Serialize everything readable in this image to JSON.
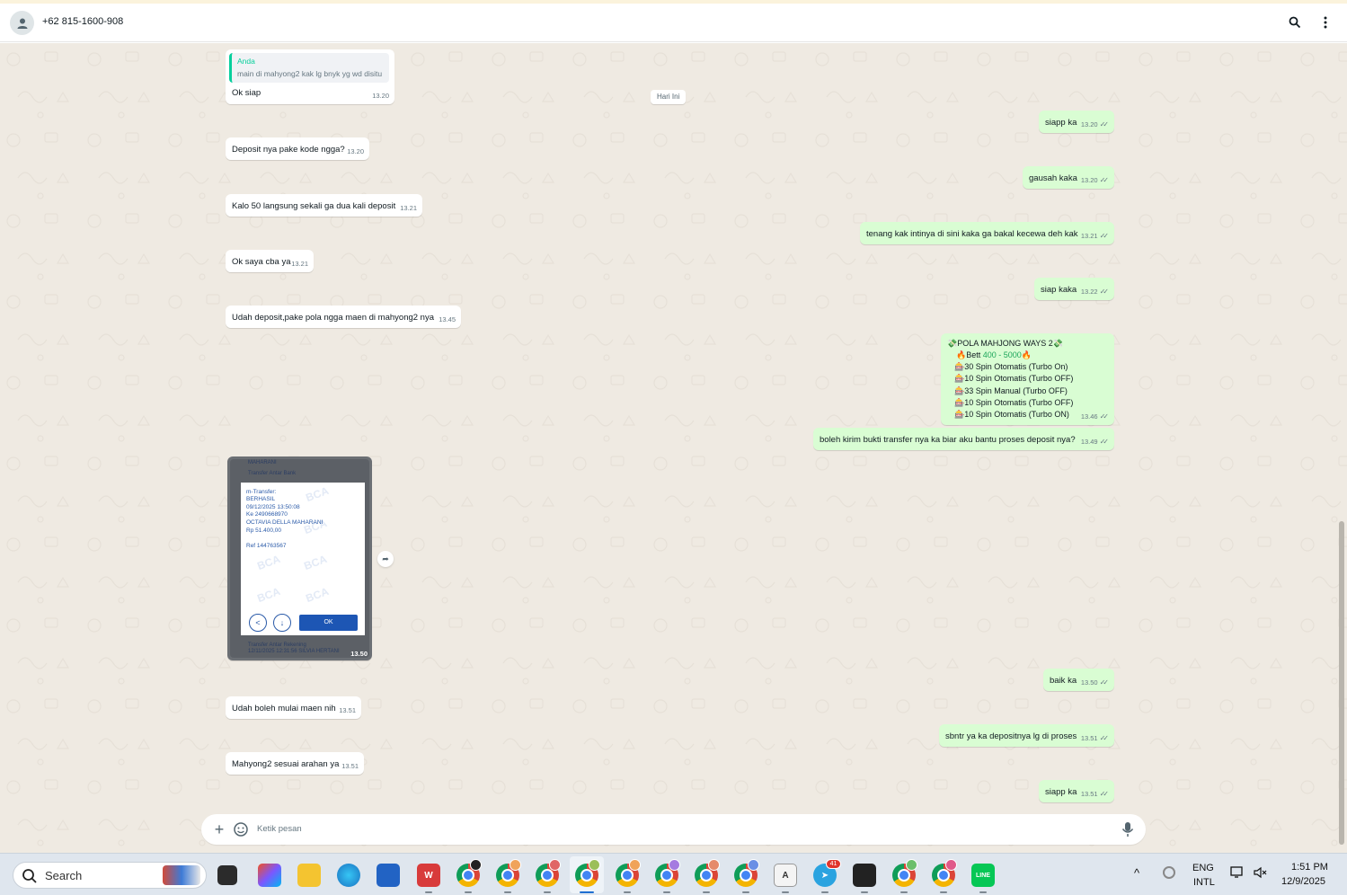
{
  "header": {
    "contact_name": "+62 815-1600-908"
  },
  "chat": {
    "day_label": "Hari Ini",
    "messages": [
      {
        "dir": "in",
        "quote_name": "Anda",
        "quote_text": "main di mahyong2 kak lg bnyk yg wd disitu",
        "text": "Ok siap",
        "time": "13.20"
      },
      {
        "dir": "out",
        "text": "siapp ka",
        "time": "13.20"
      },
      {
        "dir": "in",
        "text": "Deposit nya pake kode ngga?",
        "time": "13.20"
      },
      {
        "dir": "out",
        "text": "gausah kaka",
        "time": "13.20"
      },
      {
        "dir": "in",
        "text": "Kalo 50 langsung sekali ga dua kali deposit",
        "time": "13.21"
      },
      {
        "dir": "out",
        "text": "tenang kak intinya di sini kaka ga bakal kecewa deh kak",
        "time": "13.21"
      },
      {
        "dir": "in",
        "text": "Ok saya cba ya",
        "time": "13.21"
      },
      {
        "dir": "out",
        "text": "siap kaka",
        "time": "13.22"
      },
      {
        "dir": "in",
        "text": "Udah deposit,pake pola ngga maen di mahyong2  nya",
        "time": "13.45"
      },
      {
        "dir": "out",
        "text": "boleh kirim bukti transfer nya ka biar aku bantu proses deposit nya?",
        "time": "13.49"
      },
      {
        "dir": "out",
        "text": "baik ka",
        "time": "13.50"
      },
      {
        "dir": "in",
        "text": "Udah boleh mulai maen nih",
        "time": "13.51"
      },
      {
        "dir": "out",
        "text": "sbntr ya ka depositnya lg di proses",
        "time": "13.51"
      },
      {
        "dir": "in",
        "text": "Mahyong2 sesuai arahan ya",
        "time": "13.51"
      },
      {
        "dir": "out",
        "text": "siapp ka",
        "time": "13.51"
      }
    ],
    "pola": {
      "title": "POLA MAHJONG WAYS 2",
      "bet_prefix": "Bett ",
      "bet_range": "400 - 5000",
      "lines": [
        "30 Spin Otomatis (Turbo On)",
        "10 Spin Otomatis (Turbo OFF)",
        "33 Spin Manual (Turbo OFF)",
        "10 Spin Otomatis (Turbo OFF)",
        "10 Spin Otomatis (Turbo ON)"
      ],
      "time": "13.46"
    },
    "image_message": {
      "time": "13.50",
      "bg_rows": [
        "MAHARANI",
        "Transfer Antar Bank",
        "Transfer Antar Rekening",
        "12/11/2025 12:31:56 SILVIA HERTANI"
      ],
      "receipt_lines": [
        "m-Transfer:",
        "BERHASIL",
        "09/12/2025 13:50:08",
        "Ke 2490668970",
        "OCTAVIA DELLA MAHARANI",
        "Rp 51.400,00",
        "",
        "Ref 144763567"
      ],
      "watermark": "BCA",
      "ok_label": "OK"
    }
  },
  "composer": {
    "placeholder": "Ketik pesan"
  },
  "taskbar": {
    "search_label": "Search",
    "telegram_badge": "41",
    "lang_top": "ENG",
    "lang_bottom": "INTL",
    "time": "1:51 PM",
    "date": "12/9/2025"
  }
}
